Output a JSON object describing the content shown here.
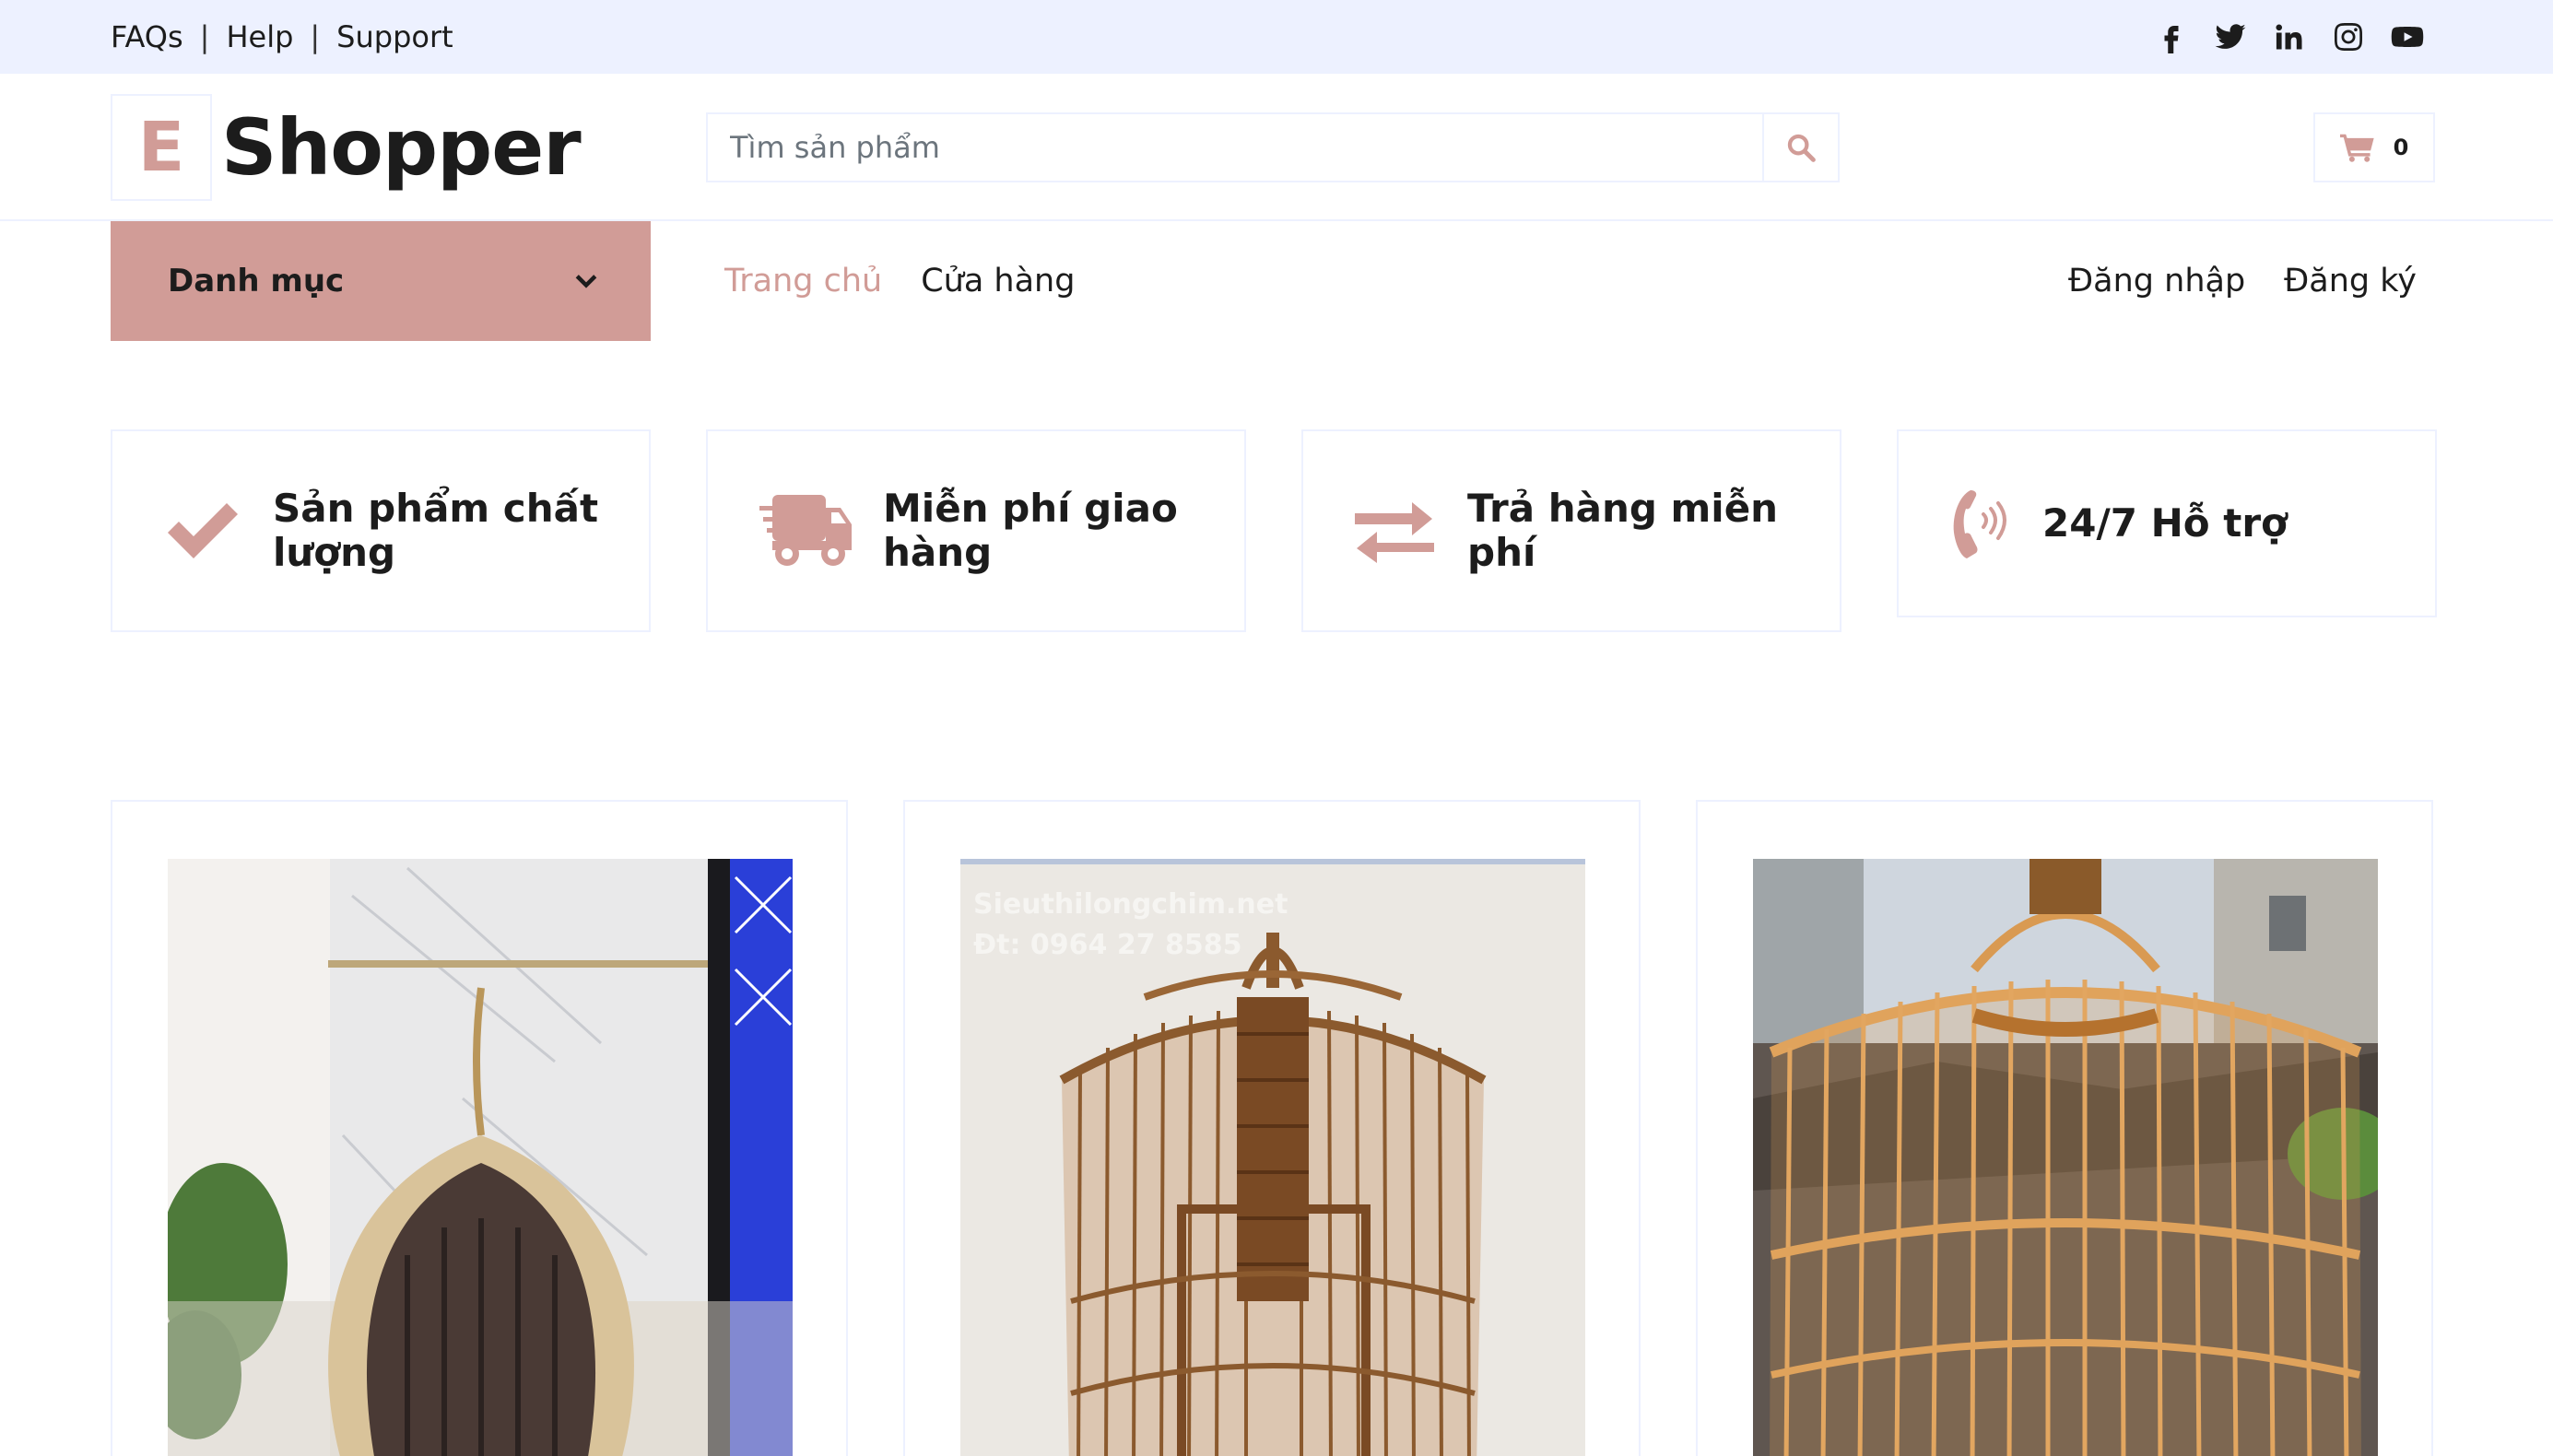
{
  "topbar": {
    "links": [
      "FAQs",
      "Help",
      "Support"
    ],
    "separator": "|",
    "socials": [
      "facebook-icon",
      "twitter-icon",
      "linkedin-icon",
      "instagram-icon",
      "youtube-icon"
    ]
  },
  "header": {
    "logo_letter": "E",
    "logo_text": "Shopper",
    "search_placeholder": "Tìm sản phẩm",
    "cart_count": "0"
  },
  "nav": {
    "category_label": "Danh mục",
    "links": [
      "Trang chủ",
      "Cửa hàng"
    ],
    "active_link": "Trang chủ",
    "auth": [
      "Đăng nhập",
      "Đăng ký"
    ]
  },
  "features": [
    {
      "icon": "check-icon",
      "line1": "Sản phẩm chất",
      "line2": "lượng"
    },
    {
      "icon": "shipping-truck-icon",
      "line1": "Miễn phí giao",
      "line2": "hàng"
    },
    {
      "icon": "exchange-arrows-icon",
      "line1": "Trả hàng miễn",
      "line2": "phí"
    },
    {
      "icon": "phone-volume-icon",
      "line1": "24/7 Hỗ trợ",
      "line2": ""
    }
  ],
  "products": [
    {
      "watermark": [
        "",
        ""
      ]
    },
    {
      "watermark": [
        "Sieuthilongchim.net",
        "Đt: 0964 27 8585"
      ]
    },
    {
      "watermark": [
        "",
        ""
      ]
    }
  ],
  "colors": {
    "primary": "#d19c97",
    "topbar_bg": "#edf1ff",
    "text": "#1c1c1c",
    "border": "#edf1ff"
  }
}
